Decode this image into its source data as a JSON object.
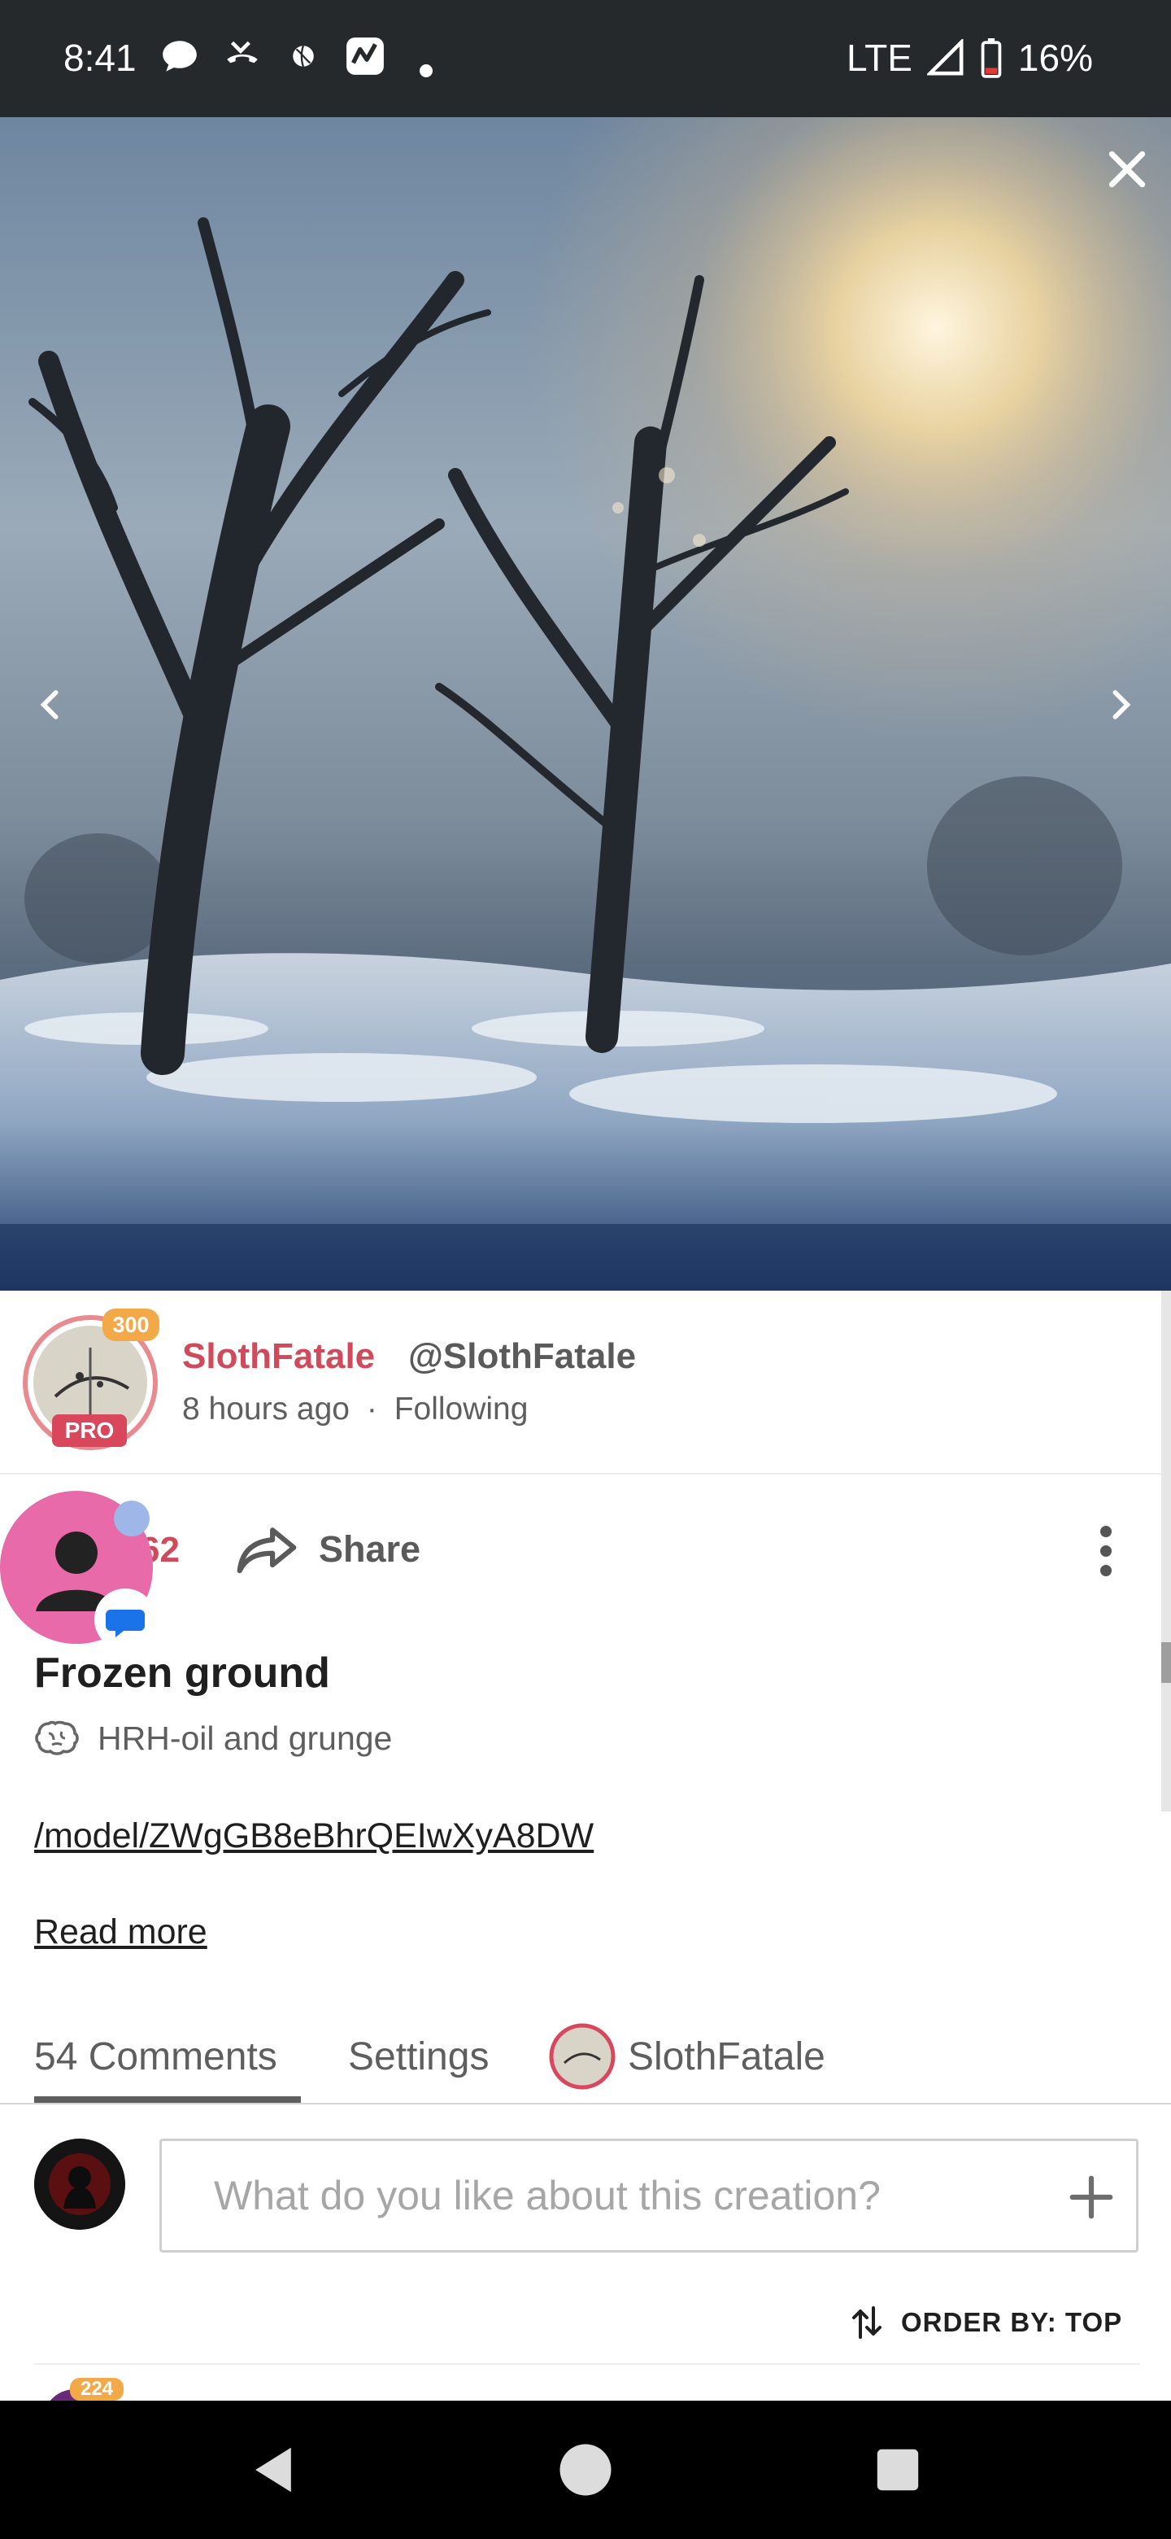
{
  "status_bar": {
    "time": "8:41",
    "network": "LTE",
    "battery": "16%",
    "icons": [
      "chat-bubble-icon",
      "missed-call-icon",
      "basketball-icon",
      "activity-app-icon",
      "dot-icon",
      "signal-icon",
      "battery-icon"
    ]
  },
  "hero": {
    "close_icon": "close-icon",
    "prev_icon": "chevron-left-icon",
    "next_icon": "chevron-right-icon"
  },
  "author": {
    "name": "SlothFatale",
    "handle": "@SlothFatale",
    "time": "8 hours ago",
    "separator": "·",
    "follow_status": "Following",
    "level": "300",
    "badge": "PRO"
  },
  "actions": {
    "like_count": "62",
    "share_label": "Share"
  },
  "post": {
    "title": "Frozen ground",
    "model": "HRH-oil and grunge",
    "link": "/model/ZWgGB8eBhrQEIwXyA8DW",
    "read_more": "Read more"
  },
  "tabs": {
    "comments": "54 Comments",
    "settings": "Settings",
    "author": "SlothFatale"
  },
  "comment_box": {
    "placeholder": "What do you like about this creation?"
  },
  "order": {
    "label": "ORDER BY: TOP"
  },
  "next_comment": {
    "level": "224"
  },
  "colors": {
    "accent": "#cf4a5b",
    "status_bar": "#26292c",
    "pro_badge": "#d8475c",
    "level_badge": "#f3a947"
  }
}
